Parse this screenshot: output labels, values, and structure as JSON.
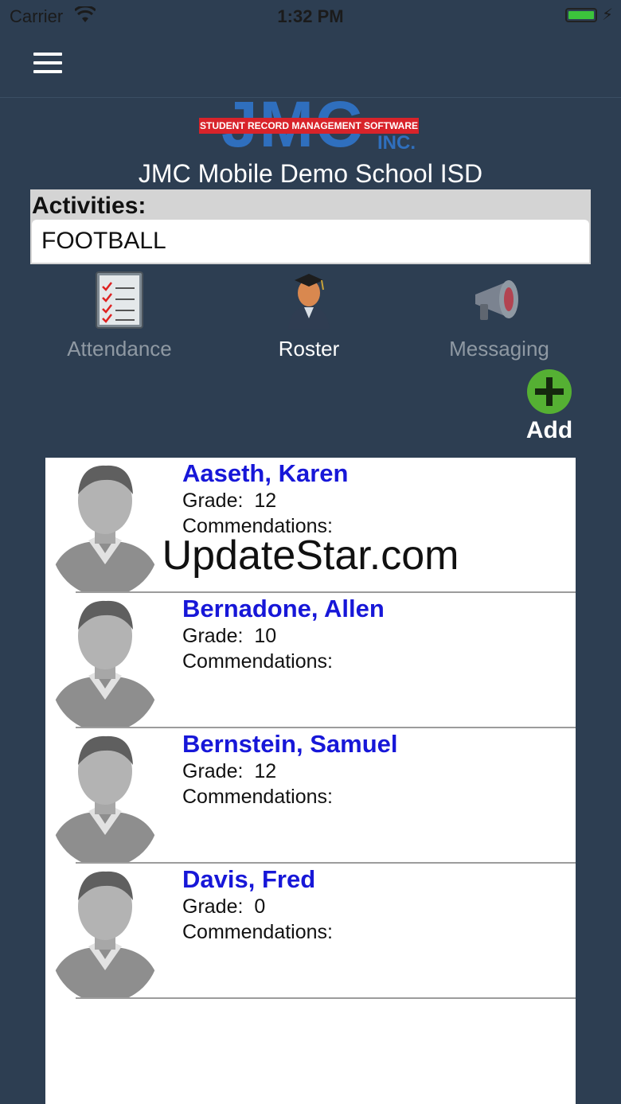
{
  "status_bar": {
    "carrier": "Carrier",
    "time": "1:32 PM"
  },
  "logo": {
    "letters": "JMC",
    "banner": "STUDENT RECORD MANAGEMENT SOFTWARE",
    "suffix": "INC."
  },
  "school_name": "JMC Mobile Demo School ISD",
  "activities": {
    "label": "Activities:",
    "value": "FOOTBALL"
  },
  "nav": {
    "attendance": "Attendance",
    "roster": "Roster",
    "messaging": "Messaging",
    "active": "roster"
  },
  "add_label": "Add",
  "students": [
    {
      "name": "Aaseth, Karen",
      "grade_label": "Grade:",
      "grade": "12",
      "commendations_label": "Commendations:"
    },
    {
      "name": "Bernadone, Allen",
      "grade_label": "Grade:",
      "grade": "10",
      "commendations_label": "Commendations:"
    },
    {
      "name": "Bernstein, Samuel",
      "grade_label": "Grade:",
      "grade": "12",
      "commendations_label": "Commendations:"
    },
    {
      "name": "Davis, Fred",
      "grade_label": "Grade:",
      "grade": "0",
      "commendations_label": "Commendations:"
    }
  ],
  "watermark": "UpdateStar.com",
  "colors": {
    "background": "#2d3e52",
    "link": "#1717d8",
    "add_green": "#55b033"
  }
}
